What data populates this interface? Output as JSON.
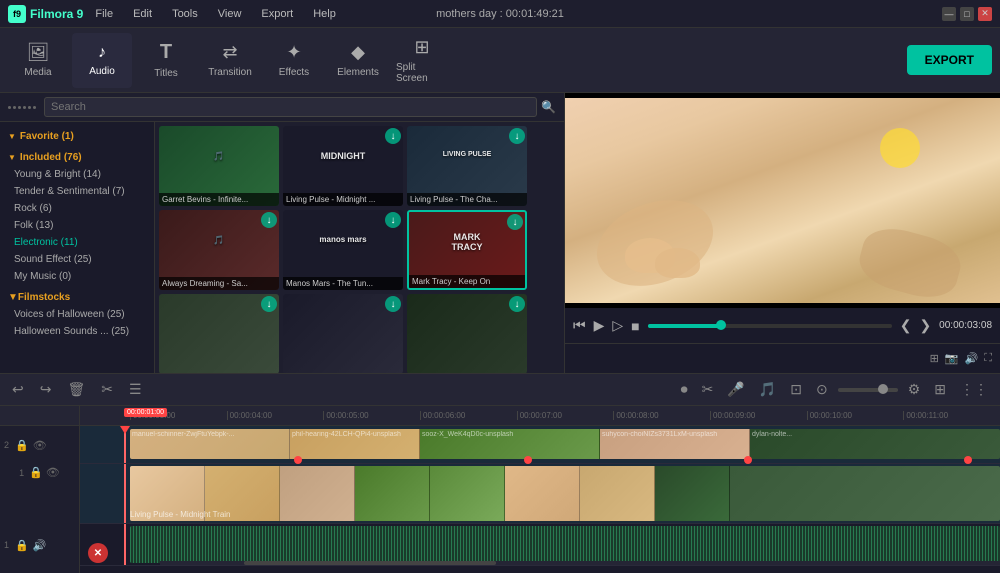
{
  "app": {
    "name": "Filmora 9",
    "title": "mothers day : 00:01:49:21"
  },
  "menu": {
    "items": [
      "File",
      "Edit",
      "Tools",
      "View",
      "Export",
      "Help"
    ]
  },
  "toolbar": {
    "items": [
      {
        "id": "media",
        "label": "Media",
        "icon": "🖼"
      },
      {
        "id": "audio",
        "label": "Audio",
        "icon": "♪"
      },
      {
        "id": "titles",
        "label": "Titles",
        "icon": "T"
      },
      {
        "id": "transition",
        "label": "Transition",
        "icon": "↔"
      },
      {
        "id": "effects",
        "label": "Effects",
        "icon": "✦"
      },
      {
        "id": "elements",
        "label": "Elements",
        "icon": "◆"
      },
      {
        "id": "split_screen",
        "label": "Split Screen",
        "icon": "⊞"
      }
    ],
    "export_label": "EXPORT",
    "active_tab": "audio"
  },
  "search": {
    "placeholder": "Search"
  },
  "sidebar": {
    "sections": [
      {
        "label": "Favorite (1)",
        "items": []
      },
      {
        "label": "Included (76)",
        "items": [
          "Young & Bright (14)",
          "Tender & Sentimental (7)",
          "Rock (6)",
          "Folk (13)",
          "Electronic (11)",
          "Sound Effect (25)",
          "My Music (0)"
        ]
      },
      {
        "label": "Filmstocks",
        "items": [
          "Voices of Halloween (25)",
          "Halloween Sounds ... (25)"
        ]
      }
    ]
  },
  "media_grid": {
    "rows": [
      [
        {
          "label": "Garret Bevins - Infinite...",
          "style": "mt-garret",
          "text": ""
        },
        {
          "label": "Living Pulse - Midnight ...",
          "style": "mt-living1",
          "text": "MIDNIGHT"
        },
        {
          "label": "Living Pulse - The Cha...",
          "style": "mt-living2",
          "text": "LIVING PULSE"
        }
      ],
      [
        {
          "label": "Always Dreaming - Sa...",
          "style": "mt-always",
          "text": ""
        },
        {
          "label": "Manos Mars - The Tun...",
          "style": "mt-manos",
          "text": "manos mars"
        },
        {
          "label": "Mark Tracy - Keep On",
          "style": "mt-mark",
          "text": "MARK TRACY"
        }
      ],
      [
        {
          "label": "",
          "style": "mt-row3a",
          "text": ""
        },
        {
          "label": "",
          "style": "mt-row3b",
          "text": ""
        },
        {
          "label": "",
          "style": "mt-row3c",
          "text": ""
        }
      ]
    ]
  },
  "preview": {
    "time": "00:00:03:08"
  },
  "timeline": {
    "ruler_marks": [
      "00:00:03:00",
      "00:00:04:00",
      "00:00:05:00",
      "00:00:06:00",
      "00:00:07:00",
      "00:00:08:00",
      "00:00:09:00",
      "00:00:10:00",
      "00:00:11:00"
    ],
    "playhead_time": "00:00:01:00",
    "tracks": [
      {
        "num": "2",
        "clips": [
          "manuel-schinner-ZwjFtuYebpk-...",
          "phil-hearing-42LCH-QPi4-unsplash",
          "sooz-X_WeK4qD0c-unsplash",
          "suhycon-choiNIZs3731LxM-unsplash",
          "dylan-nolte..."
        ]
      },
      {
        "num": "1",
        "clips": [
          "Living Pulse - Midnight Train"
        ]
      },
      {
        "num": "1",
        "type": "audio",
        "clips": []
      }
    ]
  },
  "window_controls": {
    "minimize": "—",
    "maximize": "□",
    "close": "✕"
  },
  "colors": {
    "accent": "#00c2a0",
    "playhead": "#ff4444",
    "active_text": "#00c2a0",
    "export_bg": "#00c2a0"
  }
}
